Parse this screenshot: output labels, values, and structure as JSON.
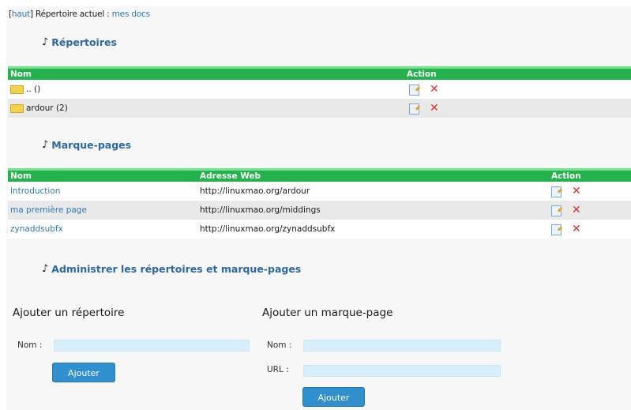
{
  "header": {
    "haut_link": "haut",
    "current_label": "Répertoire actuel :",
    "current_dir": "mes docs"
  },
  "sections": {
    "repertoires": "Répertoires",
    "marque_pages": "Marque-pages",
    "administrer": "Administrer les répertoires et marque-pages"
  },
  "repertoires_table": {
    "col_nom": "Nom",
    "col_action": "Action",
    "rows": [
      {
        "name": ".. ()"
      },
      {
        "name": "ardour (2)"
      }
    ]
  },
  "marque_pages_table": {
    "col_nom": "Nom",
    "col_adresse": "Adresse Web",
    "col_action": "Action",
    "rows": [
      {
        "name": "introduction",
        "url": "http://linuxmao.org/ardour"
      },
      {
        "name": "ma première page",
        "url": "http://linuxmao.org/middings"
      },
      {
        "name": "zynaddsubfx",
        "url": "http://linuxmao.org/zynaddsubfx"
      }
    ]
  },
  "add_repertoire": {
    "title": "Ajouter un répertoire",
    "nom_label": "Nom :",
    "nom_value": "",
    "button": "Ajouter"
  },
  "add_marque_page": {
    "title": "Ajouter un marque-page",
    "nom_label": "Nom :",
    "nom_value": "",
    "url_label": "URL :",
    "url_value": "",
    "button": "Ajouter"
  },
  "icons": {
    "note": "music-note-icon",
    "folder": "folder-icon",
    "edit": "edit-icon",
    "delete": "delete-icon"
  },
  "colors": {
    "header_green": "#24b24c",
    "link_blue": "#2a7ab8",
    "button_blue": "#2f8fcf",
    "input_bg": "#d6effa",
    "delete_red": "#e0302a"
  }
}
